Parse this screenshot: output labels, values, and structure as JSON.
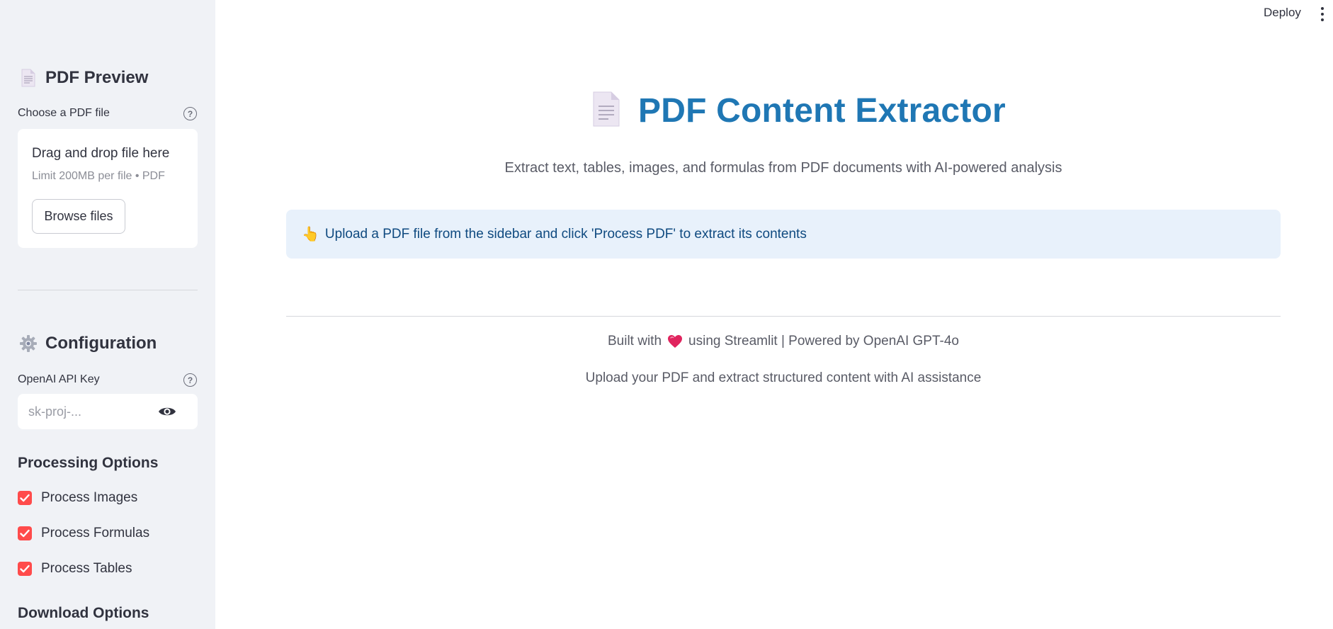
{
  "header": {
    "deploy_label": "Deploy",
    "menu_icon": "kebab-menu-icon"
  },
  "sidebar": {
    "pdf_preview": {
      "title": "PDF Preview",
      "icon": "document-icon",
      "file_label": "Choose a PDF file",
      "drag_text": "Drag and drop file here",
      "limit_text": "Limit 200MB per file • PDF",
      "browse_label": "Browse files"
    },
    "configuration": {
      "title": "Configuration",
      "icon": "gear-icon",
      "api_key_label": "OpenAI API Key",
      "api_key_placeholder": "sk-proj-...",
      "api_key_value": ""
    },
    "processing": {
      "title": "Processing Options",
      "options": [
        {
          "label": "Process Images",
          "checked": true
        },
        {
          "label": "Process Formulas",
          "checked": true
        },
        {
          "label": "Process Tables",
          "checked": true
        }
      ]
    },
    "download": {
      "title": "Download Options"
    }
  },
  "main": {
    "title": "PDF Content Extractor",
    "subtitle": "Extract text, tables, images, and formulas from PDF documents with AI-powered analysis",
    "info_message": "Upload a PDF file from the sidebar and click 'Process PDF' to extract its contents",
    "footer": {
      "built_with_prefix": "Built with",
      "built_with_suffix": "using Streamlit | Powered by OpenAI GPT-4o",
      "tagline": "Upload your PDF and extract structured content with AI assistance"
    }
  },
  "colors": {
    "sidebar_bg": "#f0f2f6",
    "title_blue": "#1f77b4",
    "checkbox_red": "#ff4b4b",
    "info_bg": "#e8f1fb",
    "info_text": "#0f4a80"
  }
}
